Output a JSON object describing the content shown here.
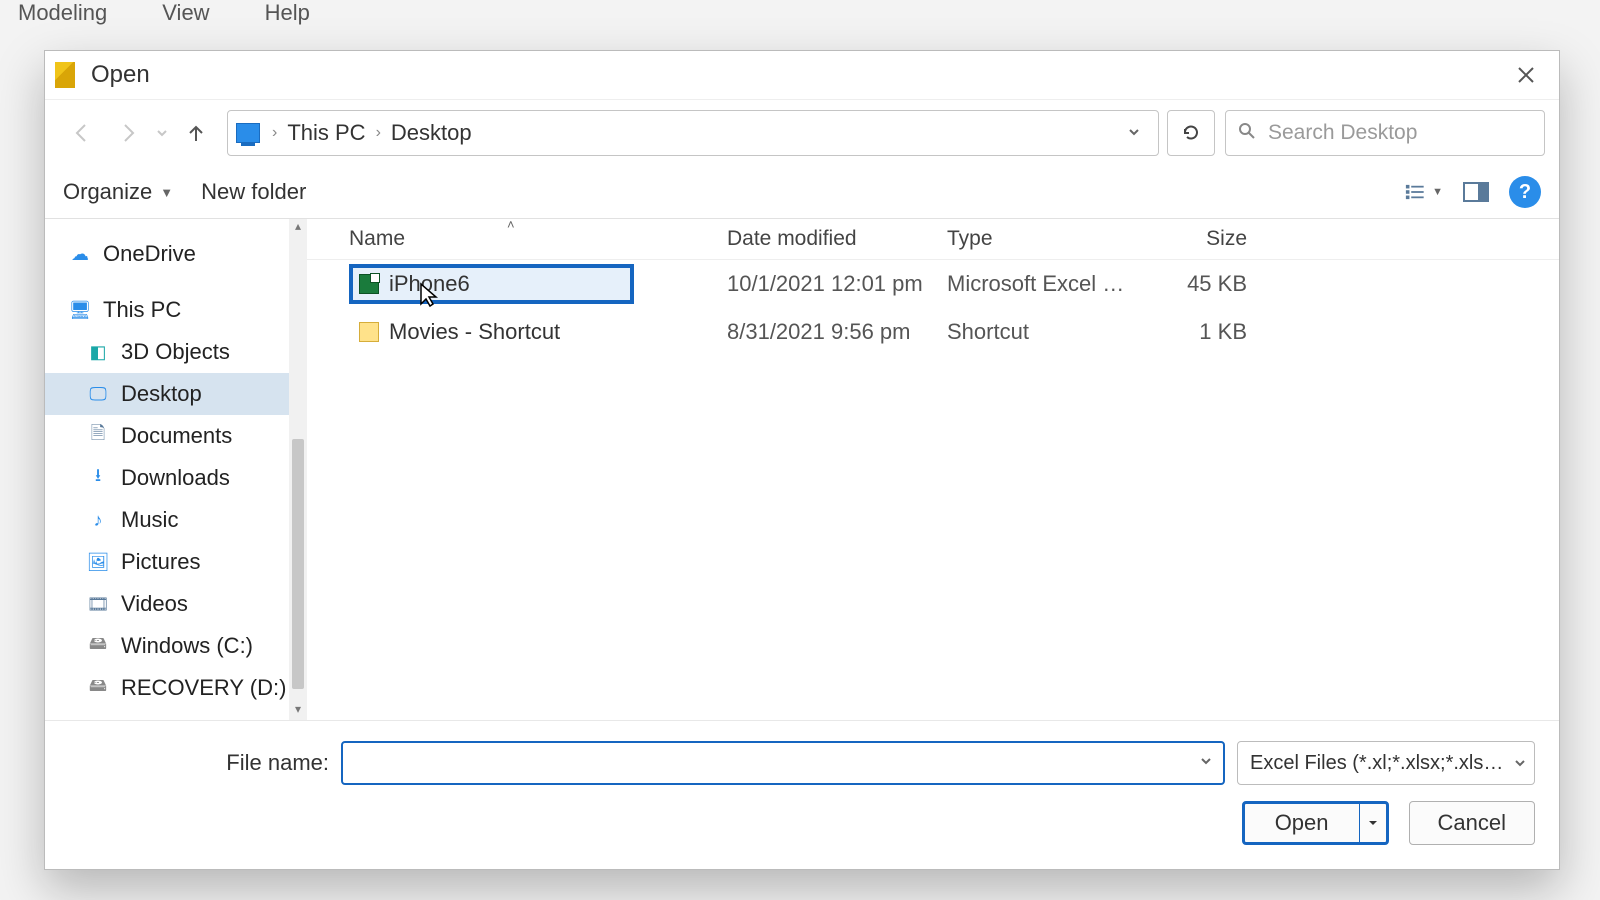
{
  "bg_menu": {
    "modeling": "Modeling",
    "view": "View",
    "help": "Help"
  },
  "dialog": {
    "title": "Open",
    "nav": {
      "back": "←",
      "forward": "→",
      "up": "↑"
    },
    "breadcrumb": {
      "root": "This PC",
      "current": "Desktop"
    },
    "search_placeholder": "Search Desktop",
    "toolbar": {
      "organize": "Organize",
      "new_folder": "New folder"
    },
    "tree": {
      "onedrive": "OneDrive",
      "thispc": "This PC",
      "objects3d": "3D Objects",
      "desktop": "Desktop",
      "documents": "Documents",
      "downloads": "Downloads",
      "music": "Music",
      "pictures": "Pictures",
      "videos": "Videos",
      "cdrive": "Windows (C:)",
      "recovery": "RECOVERY (D:)"
    },
    "columns": {
      "name": "Name",
      "date": "Date modified",
      "type": "Type",
      "size": "Size"
    },
    "files": [
      {
        "name": "iPhone6",
        "date": "10/1/2021 12:01 pm",
        "type": "Microsoft Excel W…",
        "size": "45 KB",
        "kind": "excel",
        "selected": true
      },
      {
        "name": "Movies - Shortcut",
        "date": "8/31/2021 9:56 pm",
        "type": "Shortcut",
        "size": "1 KB",
        "kind": "short",
        "selected": false
      }
    ],
    "file_name_label": "File name:",
    "file_name_value": "",
    "filter": "Excel Files (*.xl;*.xlsx;*.xlsm;*.xl",
    "open": "Open",
    "cancel": "Cancel",
    "help": "?"
  }
}
